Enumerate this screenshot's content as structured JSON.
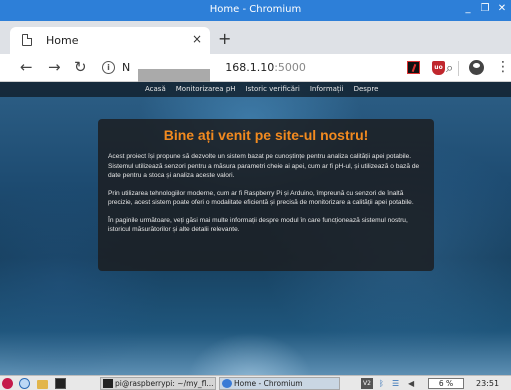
{
  "window": {
    "title": "Home - Chromium",
    "min": "_",
    "max": "❐",
    "close": "✕"
  },
  "tab": {
    "label": "Home",
    "close": "×",
    "new": "+"
  },
  "toolbar": {
    "back": "←",
    "forward": "→",
    "reload": "↻",
    "url_visible_prefix": "N",
    "url_host": "168.1.10",
    "url_port": ":5000",
    "zoom_icon": "⌕",
    "star_icon": "☆",
    "menu_icon": "⋮"
  },
  "site": {
    "nav": [
      "Acasă",
      "Monitorizarea pH",
      "Istoric verificări",
      "Informații",
      "Despre"
    ],
    "heading": "Bine ați venit pe site-ul nostru!",
    "paragraphs": [
      "Acest proiect își propune să dezvolte un sistem bazat pe cunoștințe pentru analiza calității apei potabile. Sistemul utilizează senzori pentru a măsura parametri cheie ai apei, cum ar fi pH-ul, și utilizează o bază de date pentru a stoca și analiza aceste valori.",
      "Prin utilizarea tehnologiilor moderne, cum ar fi Raspberry Pi și Arduino, împreună cu senzori de înaltă precizie, acest sistem poate oferi o modalitate eficientă și precisă de monitorizare a calității apei potabile.",
      "În paginile următoare, veți găsi mai multe informații despre modul în care funcționează sistemul nostru, istoricul măsurătorilor și alte detalii relevante."
    ]
  },
  "taskbar": {
    "tasks": [
      "pi@raspberrypi: ~/my_fl...",
      "Home - Chromium"
    ],
    "vnc": "V2",
    "bt": "ᛒ",
    "wifi": "☰",
    "vol": "◀",
    "cpu": "6 %",
    "time": "23:51"
  }
}
